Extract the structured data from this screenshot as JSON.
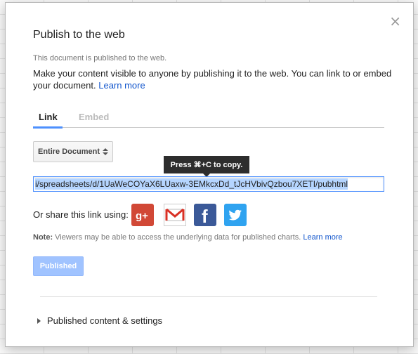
{
  "dialog": {
    "title": "Publish to the web",
    "close_glyph": "×",
    "status": "This document is published to the web.",
    "description": "Make your content visible to anyone by publishing it to the web. You can link to or embed your document.",
    "learn_more": "Learn more"
  },
  "tabs": [
    {
      "label": "Link",
      "active": true
    },
    {
      "label": "Embed",
      "active": false
    }
  ],
  "scope_select": {
    "value": "Entire Document"
  },
  "copy_tooltip": "Press ⌘+C to copy.",
  "url_field": {
    "value": "i/spreadsheets/d/1UaWeCOYaX6LUaxw-3EMkcxDd_tJcHVbivQzbou7XETI/pubhtml"
  },
  "share": {
    "label": "Or share this link using:",
    "services": [
      {
        "name": "google-plus",
        "glyph": "g+",
        "color": "#d14836"
      },
      {
        "name": "gmail",
        "glyph": "M",
        "color": "#d93025"
      },
      {
        "name": "facebook",
        "glyph": "f",
        "color": "#3b5998"
      },
      {
        "name": "twitter",
        "color": "#2fa3f0"
      }
    ]
  },
  "note": {
    "prefix": "Note:",
    "text": "Viewers may be able to access the underlying data for published charts.",
    "learn_more": "Learn more"
  },
  "publish_button": {
    "label": "Published",
    "color": "#a0c3ff"
  },
  "settings_expander": {
    "label": "Published content & settings"
  }
}
